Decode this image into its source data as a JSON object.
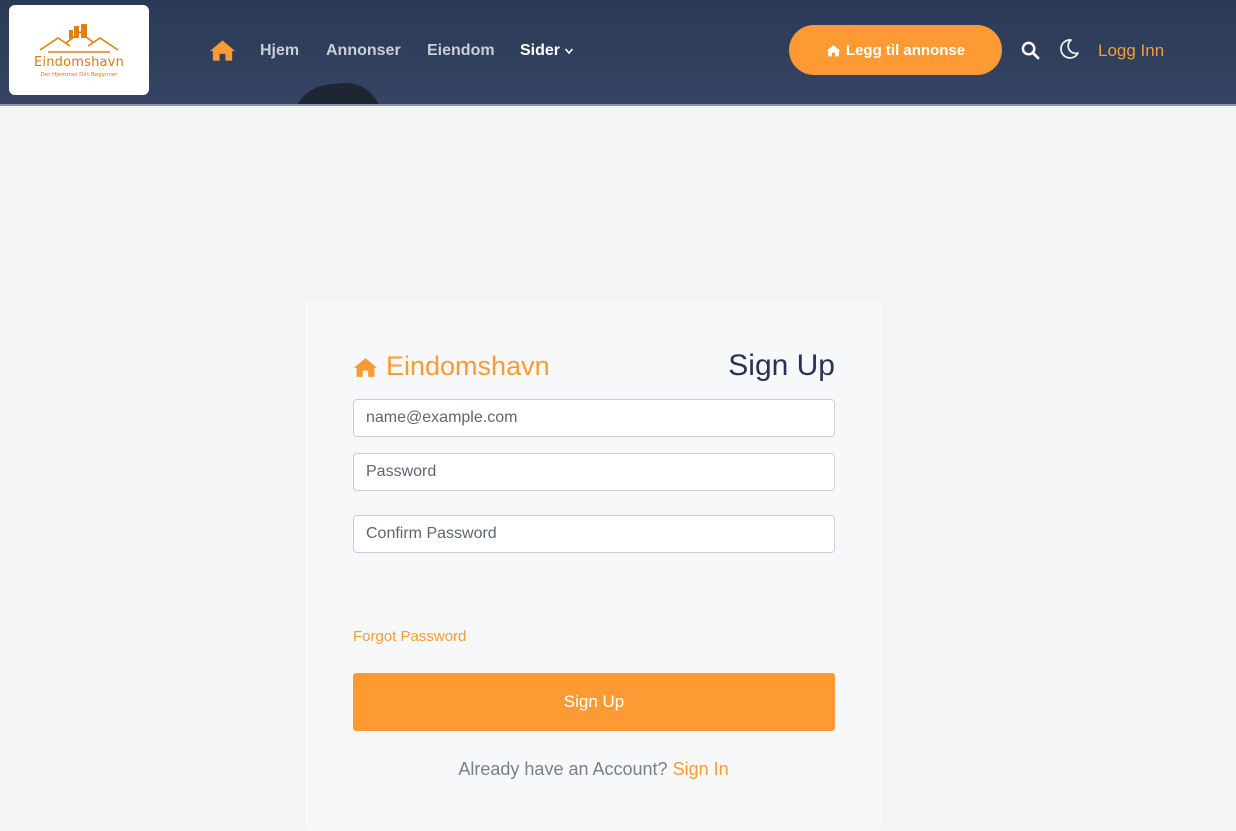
{
  "header": {
    "logo": {
      "name": "Eindomshavn",
      "tagline": "Der Hjemmet Ditt Begynner"
    },
    "nav": [
      {
        "label": "Hjem",
        "active": false
      },
      {
        "label": "Annonser",
        "active": false
      },
      {
        "label": "Eiendom",
        "active": false
      },
      {
        "label": "Sider",
        "active": true,
        "has_dropdown": true
      }
    ],
    "add_listing_label": "Legg til annonse",
    "login_label": "Logg Inn",
    "icons": [
      "home-icon",
      "search-icon",
      "moon-icon",
      "chevron-down-icon"
    ]
  },
  "form": {
    "brand": "Eindomshavn",
    "title": "Sign Up",
    "email_placeholder": "name@example.com",
    "password_placeholder": "Password",
    "confirm_placeholder": "Confirm Password",
    "forgot_label": "Forgot Password",
    "submit_label": "Sign Up",
    "account_prompt": "Already have an Account?",
    "signin_label": "Sign In"
  },
  "colors": {
    "accent": "#fd9a33",
    "header_bg": "#2b3a55",
    "title_text": "#2b3350",
    "card_bg": "#f7f8fa",
    "page_bg": "#f4f4f4"
  }
}
